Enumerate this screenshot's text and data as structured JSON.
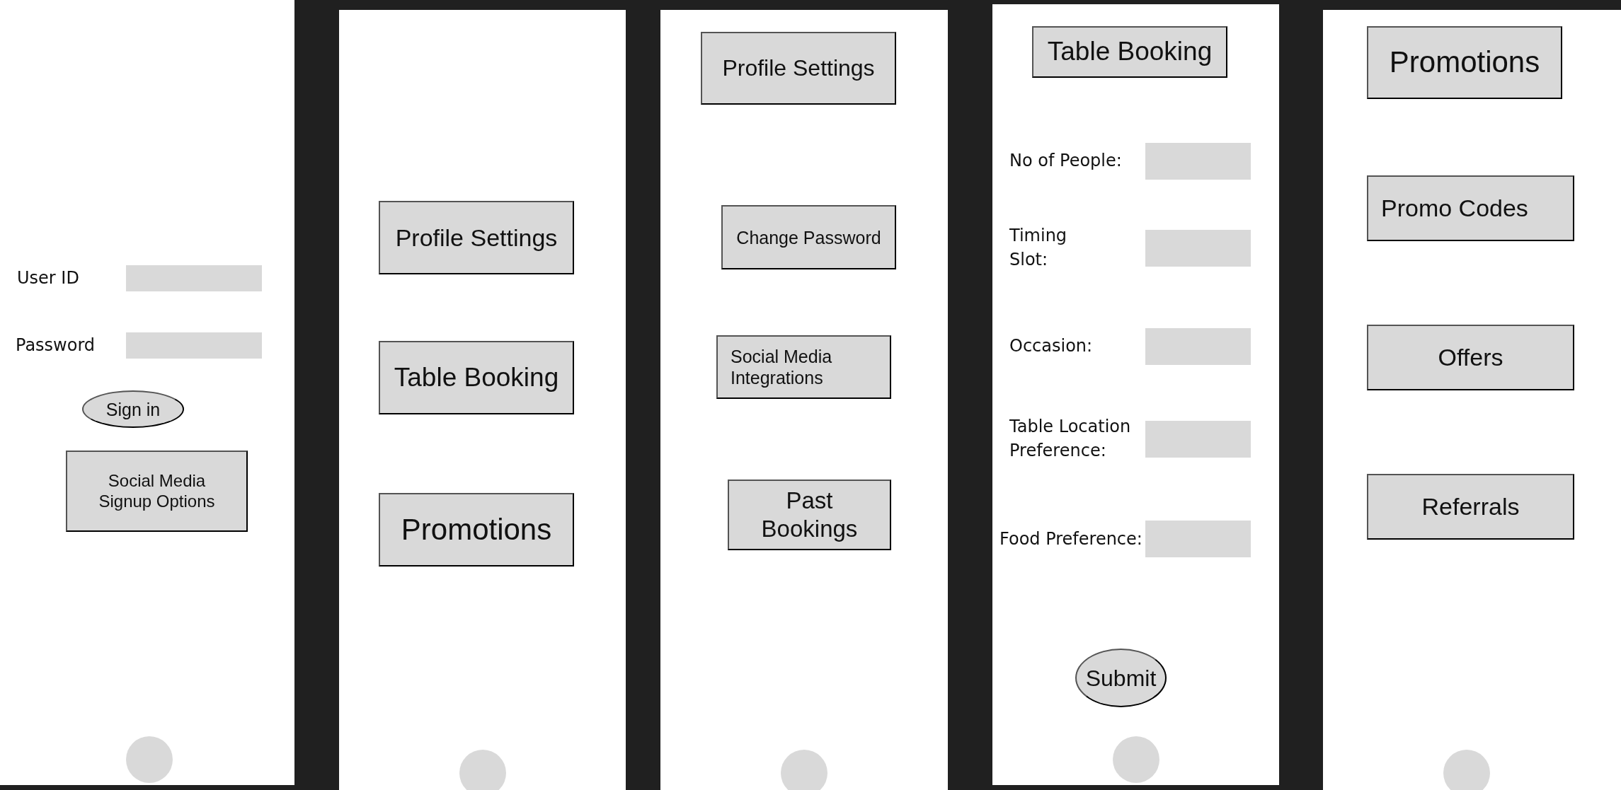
{
  "screens": [
    {
      "items": [
        {
          "kind": "field",
          "label": "User ID"
        },
        {
          "kind": "field",
          "label": "Password"
        },
        {
          "kind": "pill",
          "label": "Sign in"
        },
        {
          "kind": "box",
          "label": "Social Media\nSignup Options"
        }
      ]
    },
    {
      "items": [
        {
          "kind": "box",
          "label": "Profile Settings"
        },
        {
          "kind": "box",
          "label": "Table Booking"
        },
        {
          "kind": "box",
          "label": "Promotions"
        }
      ]
    },
    {
      "items": [
        {
          "kind": "box",
          "label": "Profile Settings"
        },
        {
          "kind": "box",
          "label": "Change Password"
        },
        {
          "kind": "box",
          "label": "Social Media\nIntegrations"
        },
        {
          "kind": "box",
          "label": "Past\nBookings"
        }
      ]
    },
    {
      "items": [
        {
          "kind": "box",
          "label": "Table Booking"
        },
        {
          "kind": "field",
          "label": "No of People:"
        },
        {
          "kind": "field",
          "label": "Timing\nSlot:"
        },
        {
          "kind": "field",
          "label": "Occasion:"
        },
        {
          "kind": "field",
          "label": "Table Location\nPreference:"
        },
        {
          "kind": "field",
          "label": "Food Preference:"
        },
        {
          "kind": "pill",
          "label": "Submit"
        }
      ]
    },
    {
      "items": [
        {
          "kind": "box",
          "label": "Promotions"
        },
        {
          "kind": "box",
          "label": "Promo Codes"
        },
        {
          "kind": "box",
          "label": "Offers"
        },
        {
          "kind": "box",
          "label": "Referrals"
        }
      ]
    }
  ]
}
